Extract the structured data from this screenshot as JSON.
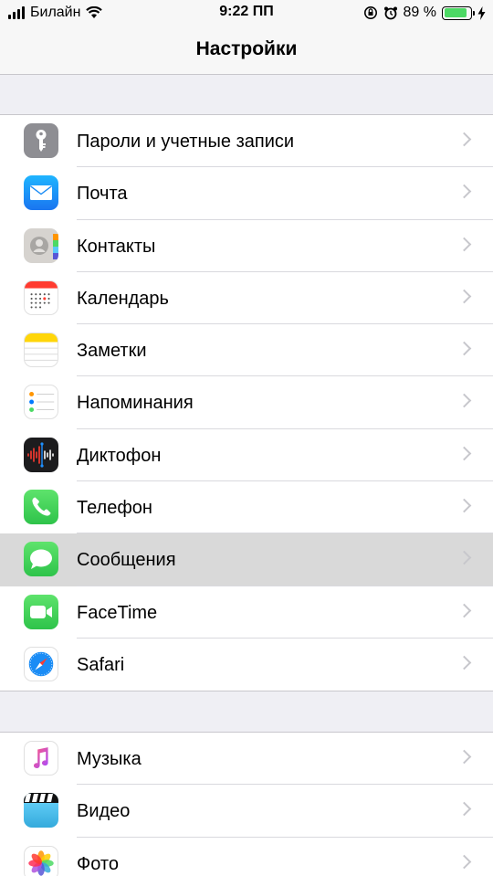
{
  "status_bar": {
    "carrier": "Билайн",
    "time": "9:22 ПП",
    "battery_percent": "89 %",
    "battery_level": 0.89
  },
  "nav": {
    "title": "Настройки"
  },
  "groups": [
    {
      "items": [
        {
          "label": "Пароли и учетные записи",
          "icon": "key-icon",
          "color": "#8e8e93"
        },
        {
          "label": "Почта",
          "icon": "mail-icon",
          "color": "#1a8cf5"
        },
        {
          "label": "Контакты",
          "icon": "contacts-icon",
          "color": "#d6d3cf"
        },
        {
          "label": "Календарь",
          "icon": "calendar-icon",
          "color": "#ffffff"
        },
        {
          "label": "Заметки",
          "icon": "notes-icon",
          "color": "#ffd60a"
        },
        {
          "label": "Напоминания",
          "icon": "reminders-icon",
          "color": "#ffffff"
        },
        {
          "label": "Диктофон",
          "icon": "voice-memos-icon",
          "color": "#1c1c1e"
        },
        {
          "label": "Телефон",
          "icon": "phone-icon",
          "color": "#4cd964"
        },
        {
          "label": "Сообщения",
          "icon": "messages-icon",
          "color": "#4cd964",
          "highlighted": true
        },
        {
          "label": "FaceTime",
          "icon": "facetime-icon",
          "color": "#4cd964"
        },
        {
          "label": "Safari",
          "icon": "safari-icon",
          "color": "#ffffff"
        }
      ]
    },
    {
      "items": [
        {
          "label": "Музыка",
          "icon": "music-icon",
          "color": "#ffffff"
        },
        {
          "label": "Видео",
          "icon": "video-icon",
          "color": "#5ac8fa"
        },
        {
          "label": "Фото",
          "icon": "photos-icon",
          "color": "#ffffff"
        }
      ]
    }
  ]
}
